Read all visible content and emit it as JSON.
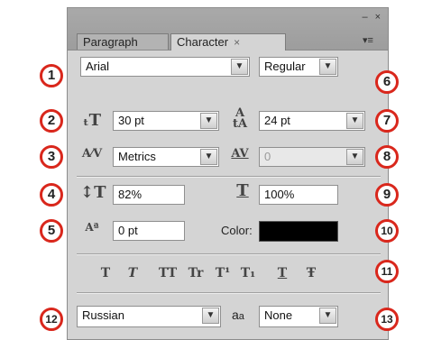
{
  "panel": {
    "tabs": [
      {
        "label": "Paragraph"
      },
      {
        "label": "Character",
        "close": "×"
      }
    ],
    "window_controls": {
      "minimize": "–",
      "close": "×"
    },
    "menu_icon": "panel-menu-icon"
  },
  "font": {
    "family": "Arial",
    "style": "Regular"
  },
  "size": {
    "font_size": "30 pt",
    "leading": "24 pt"
  },
  "spacing": {
    "kerning": "Metrics",
    "tracking": "0"
  },
  "scale": {
    "vertical": "82%",
    "horizontal": "100%"
  },
  "baseline": {
    "shift": "0 pt"
  },
  "color": {
    "label": "Color:",
    "value": "#000000"
  },
  "style_buttons": [
    "T",
    "T",
    "TT",
    "Tr",
    "T¹",
    "T₁",
    "T",
    "Ŧ"
  ],
  "language": {
    "value": "Russian",
    "antialias_label": "a",
    "antialias_label_small": "a",
    "antialias_value": "None"
  },
  "callouts": [
    "1",
    "2",
    "3",
    "4",
    "5",
    "6",
    "7",
    "8",
    "9",
    "10",
    "11",
    "12",
    "13"
  ],
  "colors": {
    "accent": "#d9271c",
    "panel": "#d4d4d4"
  }
}
